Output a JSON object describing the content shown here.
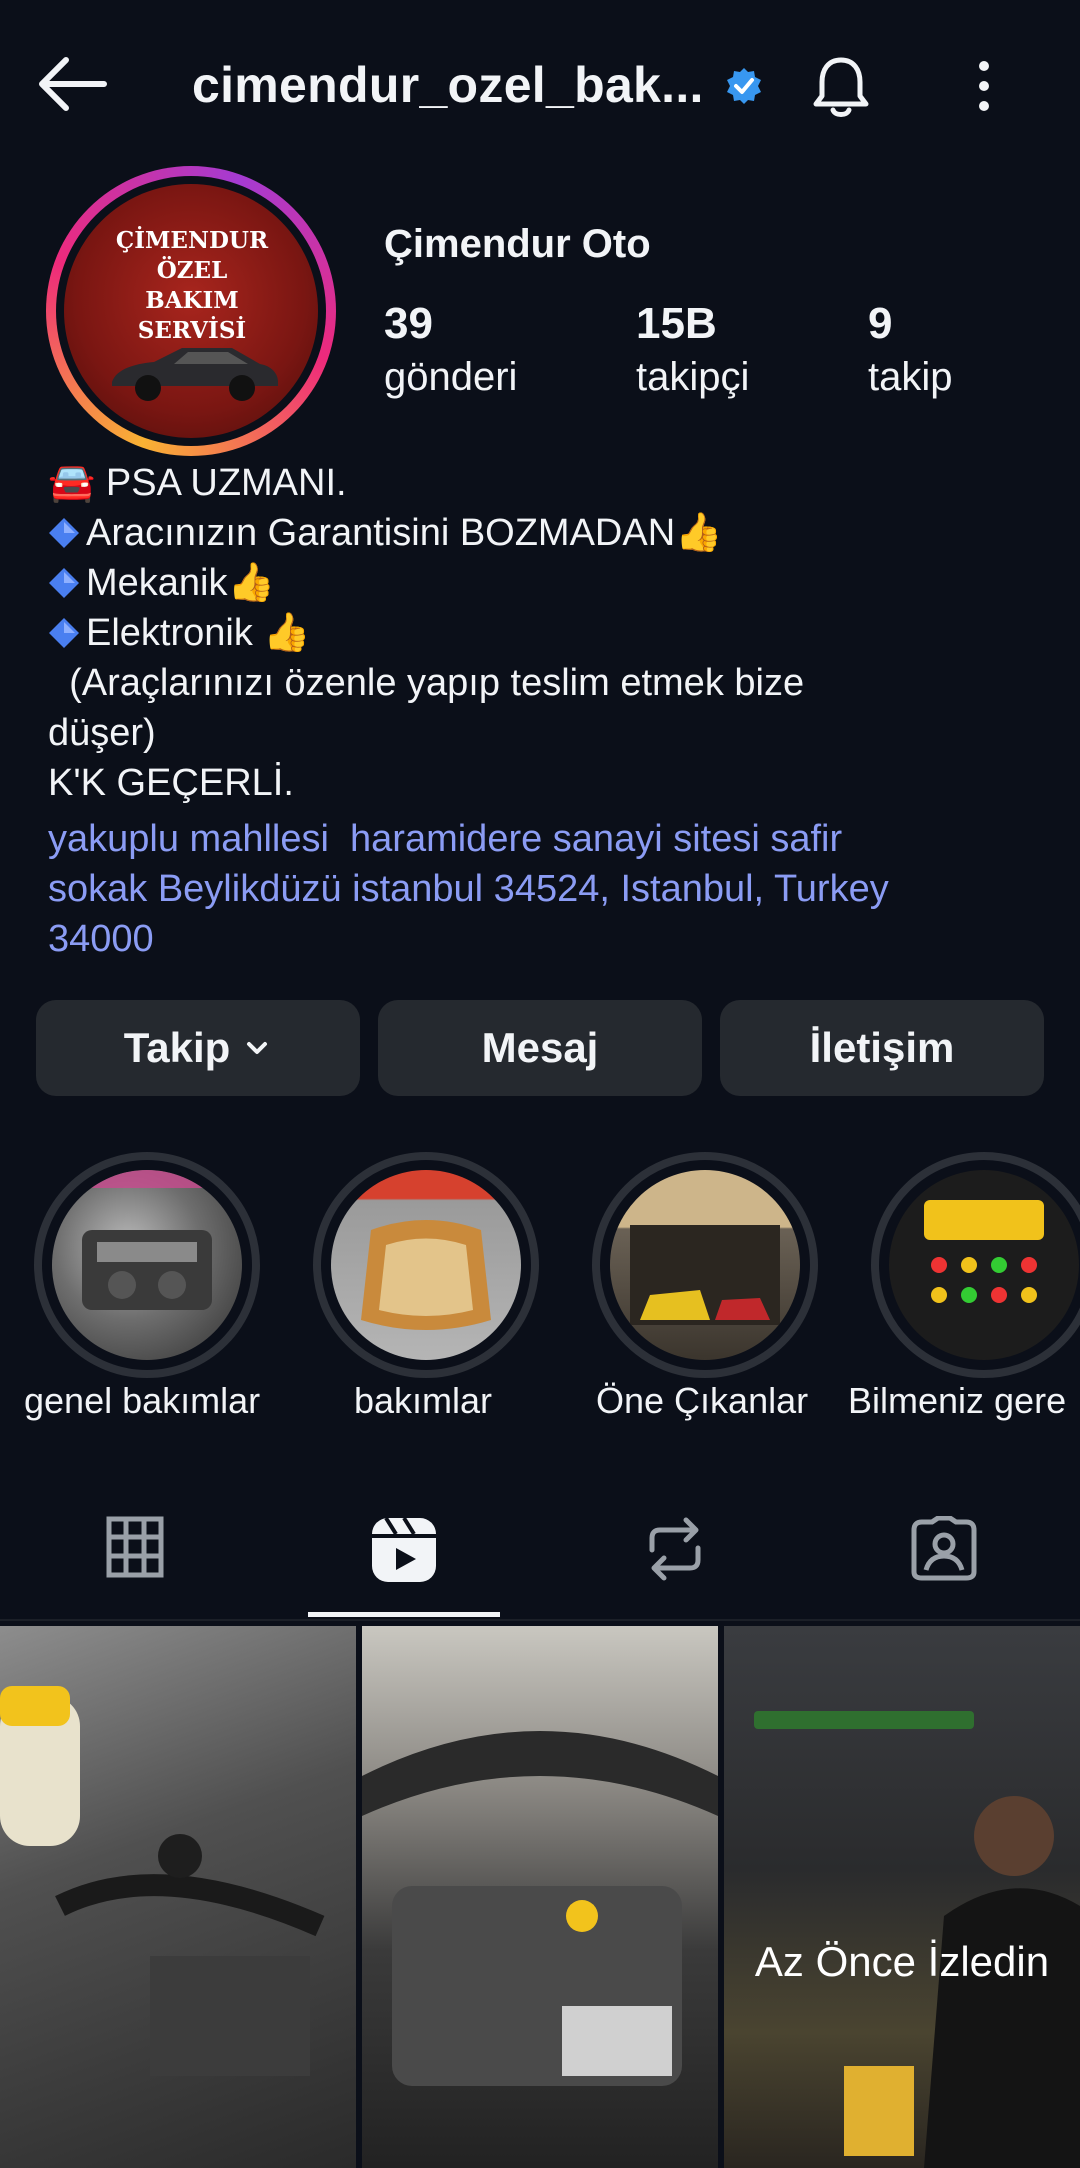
{
  "header": {
    "username": "cimendur_ozel_bak...",
    "back_icon": "arrow-left-icon",
    "verified_icon": "verified-badge-icon",
    "bell_icon": "bell-icon",
    "more_icon": "more-vertical-icon"
  },
  "profile": {
    "display_name": "Çimendur Oto",
    "avatar_text_line1": "ÇİMENDUR ÖZEL",
    "avatar_text_line2": "BAKIM SERVİSİ",
    "stats": [
      {
        "value": "39",
        "label": "gönderi"
      },
      {
        "value": "15B",
        "label": "takipçi"
      },
      {
        "value": "9",
        "label": "takip"
      }
    ]
  },
  "bio": {
    "line1": "🚘 PSA UZMANI.",
    "line2": "Aracınızın Garantisini BOZMADAN👍",
    "line3": "Mekanik👍",
    "line4": "Elektronik 👍",
    "line5": "  (Araçlarınızı özenle yapıp teslim etmek bize",
    "line6": "düşer)",
    "line7": "K'K GEÇERLİ.",
    "address_line1": "yakuplu mahllesi  haramidere sanayi sitesi safir",
    "address_line2": "sokak Beylikdüzü istanbul 34524, Istanbul, Turkey",
    "address_line3": "34000"
  },
  "actions": {
    "follow": "Takip",
    "message": "Mesaj",
    "contact": "İletişim"
  },
  "highlights": [
    {
      "label": "genel bakımlar"
    },
    {
      "label": "bakımlar"
    },
    {
      "label": "Öne Çıkanlar"
    },
    {
      "label": "Bilmeniz gere"
    }
  ],
  "tabs": {
    "active": "reels",
    "icons": [
      "grid-icon",
      "reels-icon",
      "reposts-icon",
      "tagged-icon"
    ]
  },
  "grid": {
    "third_overlay": "Az Önce İzledin"
  },
  "colors": {
    "background": "#0b0f19",
    "link": "#8b9cf4",
    "button": "#25292f",
    "verified": "#3897f0"
  }
}
